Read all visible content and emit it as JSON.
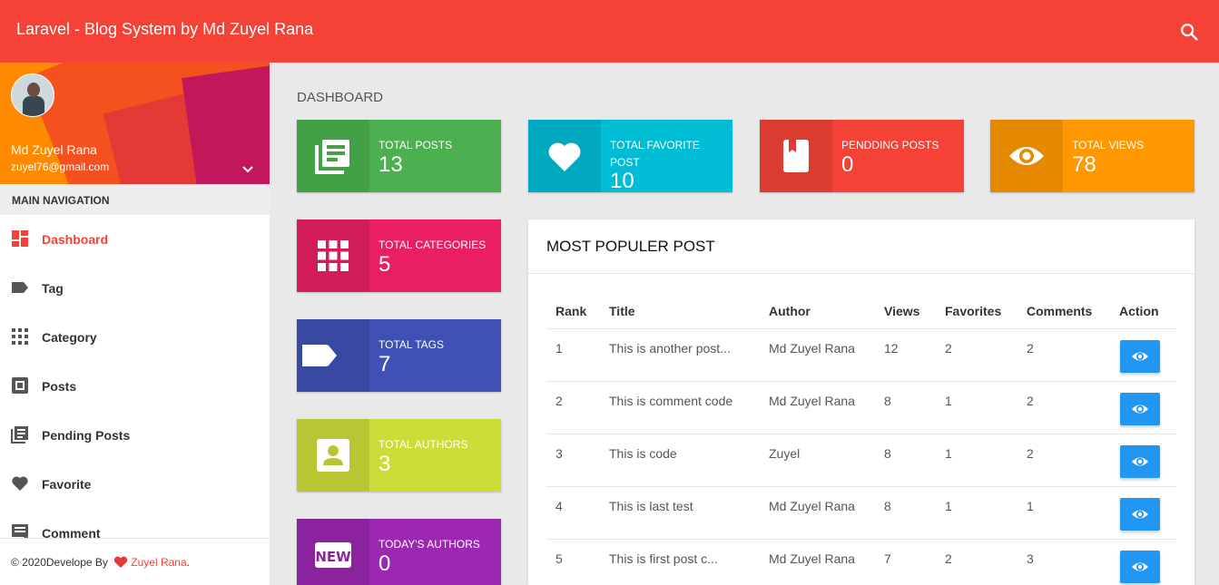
{
  "header": {
    "title": "Laravel - Blog System by Md Zuyel Rana"
  },
  "user": {
    "name": "Md Zuyel Rana",
    "email": "zuyel76@gmail.com"
  },
  "sidebar": {
    "heading": "MAIN NAVIGATION",
    "items": [
      {
        "label": "Dashboard",
        "icon": "dashboard-icon",
        "active": true
      },
      {
        "label": "Tag",
        "icon": "tag-icon"
      },
      {
        "label": "Category",
        "icon": "apps-grid-icon"
      },
      {
        "label": "Posts",
        "icon": "library-books-icon"
      },
      {
        "label": "Pending Posts",
        "icon": "library-books-icon"
      },
      {
        "label": "Favorite",
        "icon": "heart-icon"
      },
      {
        "label": "Comment",
        "icon": "comment-icon"
      }
    ],
    "footer": {
      "prefix": "© 2020Develope By",
      "author": "Zuyel Rana",
      "suffix": "."
    }
  },
  "page": {
    "title": "DASHBOARD"
  },
  "cards": [
    {
      "title": "TOTAL POSTS",
      "value": "13",
      "icon": "library-books-icon",
      "color": "#4caf50",
      "dark": "#43a047"
    },
    {
      "title": "TOTAL FAVORITE POST",
      "value": "10",
      "icon": "heart-icon",
      "color": "#00bcd4",
      "dark": "#00a9bf"
    },
    {
      "title": "PENDDING POSTS",
      "value": "0",
      "icon": "book-icon",
      "color": "#f44336",
      "dark": "#db3c30"
    },
    {
      "title": "TOTAL VIEWS",
      "value": "78",
      "icon": "eye-icon",
      "color": "#ff9800",
      "dark": "#e58900"
    },
    {
      "title": "TOTAL CATEGORIES",
      "value": "5",
      "icon": "apps-grid-icon",
      "color": "#e91e63",
      "dark": "#d21b59"
    },
    {
      "title": "TOTAL TAGS",
      "value": "7",
      "icon": "tag-icon",
      "color": "#3f51b5",
      "dark": "#3949a3"
    },
    {
      "title": "TOTAL AUTHORS",
      "value": "3",
      "icon": "account-box-icon",
      "color": "#cddc39",
      "dark": "#b9c633"
    },
    {
      "title": "TODAY'S AUTHORS",
      "value": "0",
      "icon": "new-badge-icon",
      "color": "#9c27b0",
      "dark": "#8c239e"
    }
  ],
  "popular": {
    "title": "MOST POPULER POST",
    "columns": [
      "Rank",
      "Title",
      "Author",
      "Views",
      "Favorites",
      "Comments",
      "Action"
    ],
    "rows": [
      {
        "rank": "1",
        "title": "This is another post...",
        "author": "Md Zuyel Rana",
        "views": "12",
        "favorites": "2",
        "comments": "2"
      },
      {
        "rank": "2",
        "title": "This is comment code",
        "author": "Md Zuyel Rana",
        "views": "8",
        "favorites": "1",
        "comments": "2"
      },
      {
        "rank": "3",
        "title": "This is code",
        "author": "Zuyel",
        "views": "8",
        "favorites": "1",
        "comments": "2"
      },
      {
        "rank": "4",
        "title": "This is last test",
        "author": "Md Zuyel Rana",
        "views": "8",
        "favorites": "1",
        "comments": "1"
      },
      {
        "rank": "5",
        "title": "This is first post c...",
        "author": "Md Zuyel Rana",
        "views": "7",
        "favorites": "2",
        "comments": "3"
      }
    ]
  }
}
